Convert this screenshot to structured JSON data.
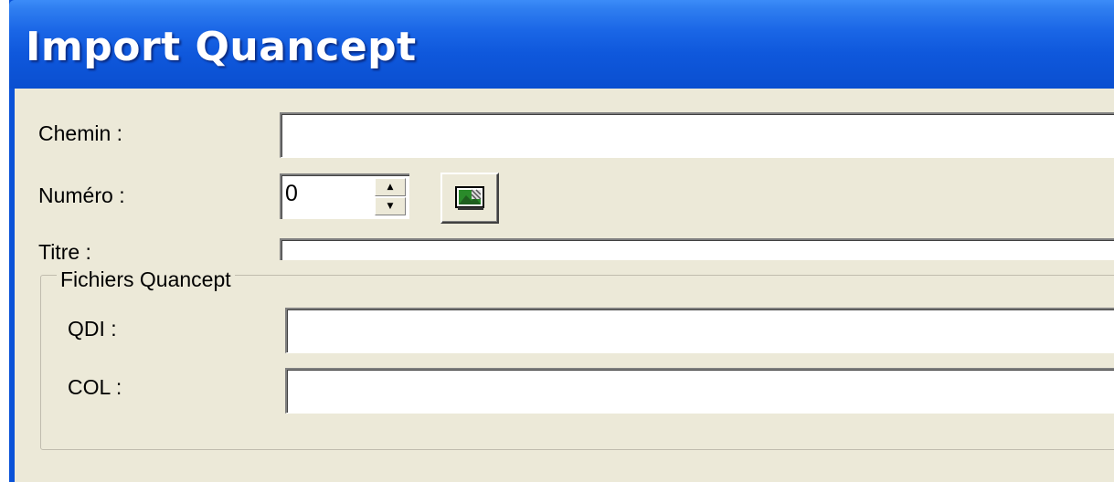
{
  "window": {
    "title": "Import Quancept"
  },
  "form": {
    "chemin": {
      "label": "Chemin :",
      "value": ""
    },
    "numero": {
      "label": "Numéro :",
      "value": "0",
      "spin_up": "▲",
      "spin_down": "▼"
    },
    "titre": {
      "label": "Titre :",
      "value": ""
    }
  },
  "group": {
    "legend": "Fichiers Quancept",
    "qdi": {
      "label": "QDI :",
      "value": ""
    },
    "col": {
      "label": "COL :",
      "value": ""
    }
  },
  "icons": {
    "pick_button_icon": "image-select-icon"
  },
  "colors": {
    "titlebar": "#0a52d8",
    "client": "#ece9d8"
  }
}
